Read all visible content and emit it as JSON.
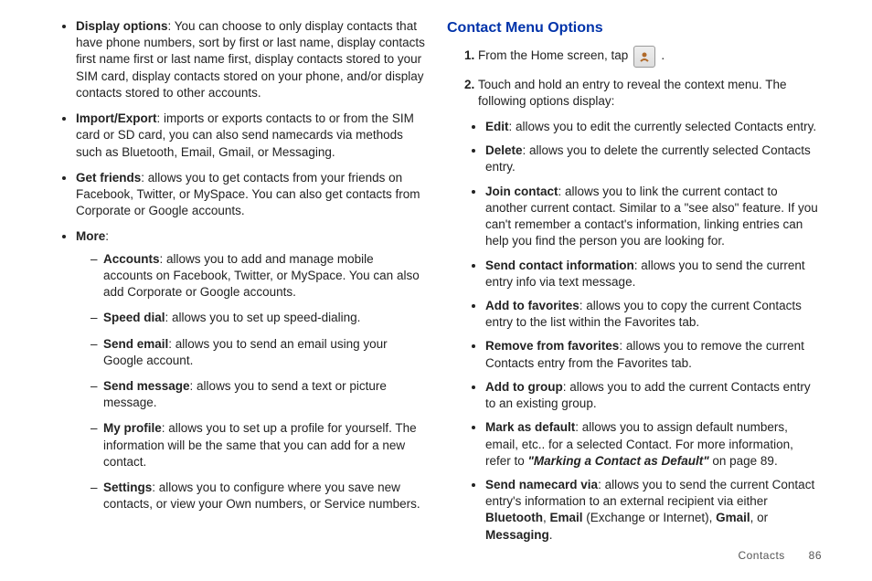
{
  "left": {
    "items": [
      {
        "label": "Display options",
        "text": ": You can choose to only display contacts that have phone numbers, sort by first or last name, display contacts first name first or last name first, display contacts stored to your SIM card, display contacts stored on your phone, and/or display contacts stored to other accounts."
      },
      {
        "label": "Import/Export",
        "text": ": imports or exports contacts to or from the SIM card or SD card, you can also send namecards via methods such as Bluetooth, Email, Gmail, or Messaging."
      },
      {
        "label": "Get friends",
        "text": ": allows you to get contacts from your friends on Facebook, Twitter, or MySpace. You can also get contacts from Corporate or Google accounts."
      }
    ],
    "more_label": "More",
    "more_items": [
      {
        "label": "Accounts",
        "text": ": allows you to add and manage mobile accounts on Facebook, Twitter, or MySpace. You can also add Corporate or Google accounts."
      },
      {
        "label": "Speed dial",
        "text": ": allows you to set up speed-dialing."
      },
      {
        "label": "Send email",
        "text": ": allows you to send an email using your Google account."
      },
      {
        "label": "Send message",
        "text": ": allows you to send a text or picture message."
      },
      {
        "label": "My profile",
        "text": ": allows you to set up a profile for yourself. The information will be the same that you can add for a new contact."
      },
      {
        "label": "Settings",
        "text": ": allows you to configure where you save new contacts, or view your Own numbers, or Service numbers."
      }
    ]
  },
  "right": {
    "heading": "Contact Menu Options",
    "step1_pre": "From the Home screen, tap",
    "step1_post": ".",
    "step2": "Touch and hold an entry to reveal the context menu. The following options display:",
    "options": [
      {
        "label": "Edit",
        "text": ": allows you to edit the currently selected Contacts entry."
      },
      {
        "label": "Delete",
        "text": ": allows you to delete the currently selected Contacts entry."
      },
      {
        "label": "Join contact",
        "text": ": allows you to link the current contact to another current contact. Similar to a \"see also\" feature. If you can't remember a contact's information, linking entries can help you find the person you are looking for."
      },
      {
        "label": "Send contact information",
        "text": ": allows you to send the current entry info via text message."
      },
      {
        "label": "Add to favorites",
        "text": ": allows you to copy the current Contacts entry to the list within the Favorites tab."
      },
      {
        "label": "Remove from favorites",
        "text": ": allows you to remove the current Contacts entry from the Favorites tab."
      },
      {
        "label": "Add to group",
        "text": ": allows you to add the current Contacts entry to an existing group."
      }
    ],
    "mark_default": {
      "label": "Mark as default",
      "pre": ": allows you to assign default numbers, email, etc.. for a selected Contact. For more information, refer to ",
      "link": "\"Marking a Contact as Default\"",
      "post": "  on page 89."
    },
    "send_namecard": {
      "label": "Send namecard via",
      "pre": ": allows you to send the current Contact entry's information to an external recipient via either ",
      "b1": "Bluetooth",
      "mid1": ", ",
      "b2": "Email",
      "mid2": " (Exchange or Internet), ",
      "b3": "Gmail",
      "mid3": ", or ",
      "b4": "Messaging",
      "end": "."
    }
  },
  "footer": {
    "section": "Contacts",
    "page": "86"
  }
}
